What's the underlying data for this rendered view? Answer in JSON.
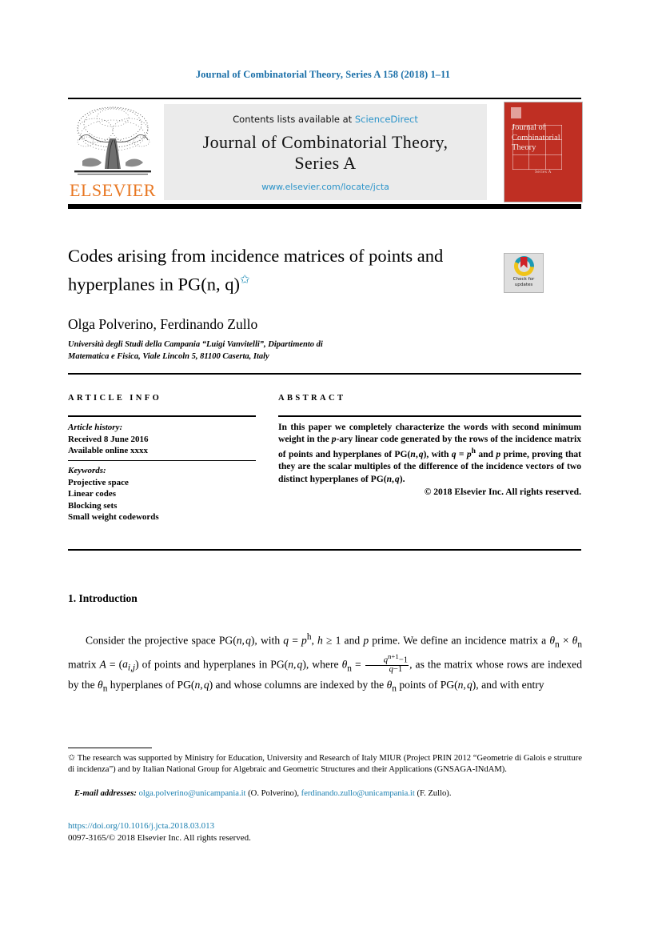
{
  "running_head": "Journal of Combinatorial Theory, Series A 158 (2018) 1–11",
  "masthead": {
    "publisher_wordmark": "ELSEVIER",
    "contents_prefix": "Contents lists available at ",
    "contents_link": "ScienceDirect",
    "journal_name_line1": "Journal of Combinatorial Theory,",
    "journal_name_line2": "Series A",
    "journal_url": "www.elsevier.com/locate/jcta",
    "cover": {
      "title": "Journal of Combinatorial Theory",
      "subtitle": "Series A"
    }
  },
  "article": {
    "title_line1": "Codes arising from incidence matrices of points and",
    "title_line2": "hyperplanes in PG(n, q)",
    "title_footnote_mark": "✩",
    "authors": "Olga Polverino, Ferdinando Zullo",
    "affiliation_line1": "Università degli Studi della Campania “Luigi Vanvitelli”, Dipartimento di",
    "affiliation_line2": "Matematica e Fisica, Viale Lincoln 5, 81100 Caserta, Italy"
  },
  "crossmark": {
    "line1": "Check for",
    "line2": "updates"
  },
  "info": {
    "heading": "ARTICLE INFO",
    "history_label": "Article history:",
    "received": "Received 8 June 2016",
    "available": "Available online xxxx",
    "keywords_label": "Keywords:",
    "keywords": [
      "Projective space",
      "Linear codes",
      "Blocking sets",
      "Small weight codewords"
    ]
  },
  "abstract": {
    "heading": "ABSTRACT",
    "text": "In this paper we completely characterize the words with second minimum weight in the p-ary linear code generated by the rows of the incidence matrix of points and hyperplanes of PG(n, q), with q = p^h and p prime, proving that they are the scalar multiples of the difference of the incidence vectors of two distinct hyperplanes of PG(n, q).",
    "copyright": "© 2018 Elsevier Inc. All rights reserved."
  },
  "body": {
    "section_number_title": "1. Introduction",
    "paragraph": "Consider the projective space PG(n, q), with q = p^h, h ≥ 1 and p prime. We define an incidence matrix a θn × θn matrix A = (ai,j) of points and hyperplanes in PG(n, q), where θn = (q^{n+1}−1)/(q−1), as the matrix whose rows are indexed by the θn hyperplanes of PG(n, q) and whose columns are indexed by the θn points of PG(n, q), and with entry"
  },
  "footnotes": {
    "funding_mark": "✩",
    "funding": "The research was supported by Ministry for Education, University and Research of Italy MIUR (Project PRIN 2012 “Geometrie di Galois e strutture di incidenza”) and by Italian National Group for Algebraic and Geometric Structures and their Applications (GNSAGA-INdAM).",
    "email_label": "E-mail addresses:",
    "email1": "olga.polverino@unicampania.it",
    "email1_owner": "(O. Polverino),",
    "email2": "ferdinando.zullo@unicampania.it",
    "email2_owner": "(F. Zullo).",
    "doi": "https://doi.org/10.1016/j.jcta.2018.03.013",
    "issn": "0097-3165/© 2018 Elsevier Inc. All rights reserved."
  },
  "colors": {
    "link_blue": "#1a7fb0",
    "header_blue": "#1a6fa8",
    "sciencedirect_blue": "#2a93c9",
    "elsevier_orange": "#e87722",
    "cover_red": "#bf2f23"
  }
}
